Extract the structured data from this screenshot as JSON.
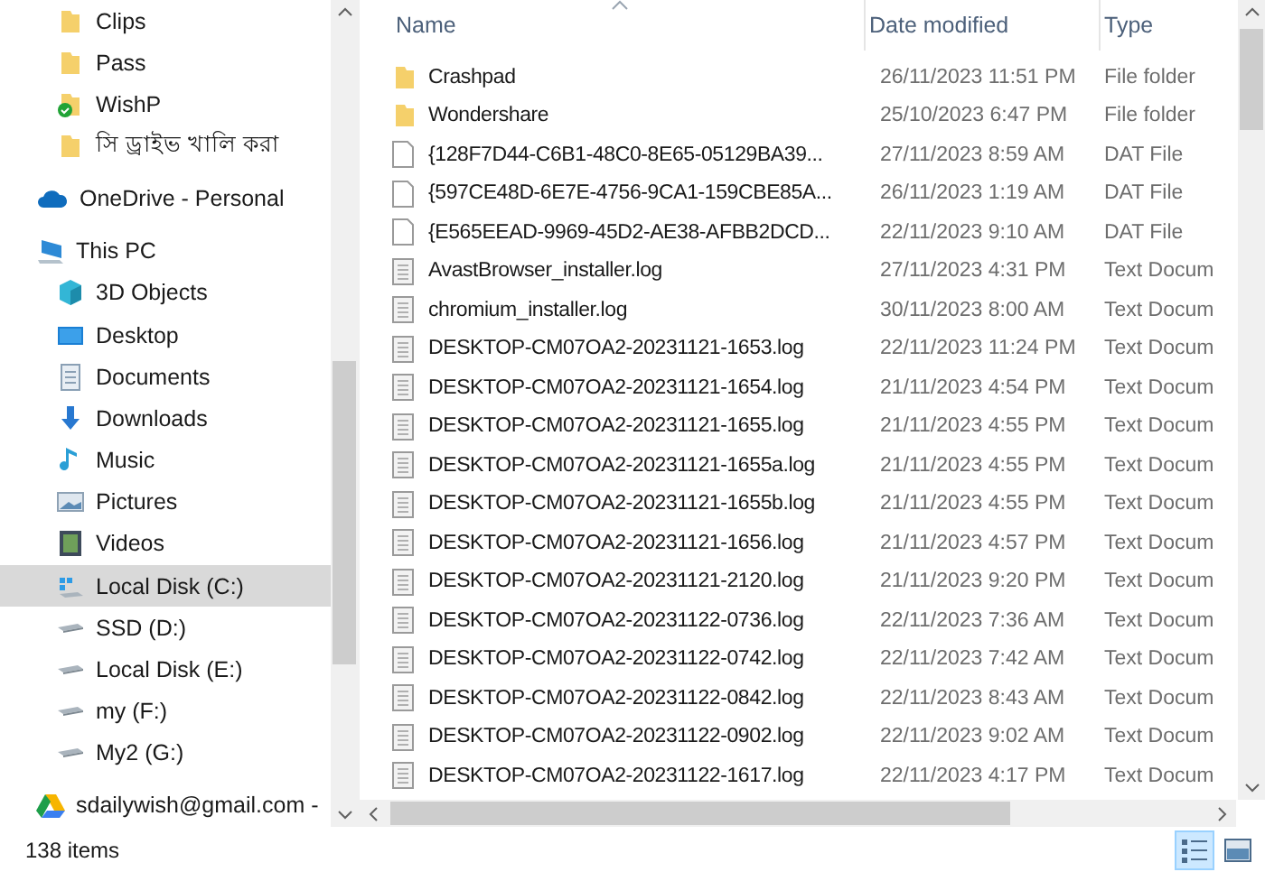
{
  "sidebar": {
    "quick_access_children": [
      {
        "label": "Clips",
        "kind": "folder",
        "selected": false
      },
      {
        "label": "Pass",
        "kind": "folder",
        "selected": false
      },
      {
        "label": "WishP",
        "kind": "synced-folder",
        "selected": false
      },
      {
        "label": "সি ড্রাইভ খালি করা",
        "kind": "folder",
        "selected": false
      }
    ],
    "items": [
      {
        "label": "OneDrive - Personal",
        "kind": "cloud",
        "selected": false
      },
      {
        "label": "This PC",
        "kind": "pc",
        "selected": false,
        "children": [
          {
            "label": "3D Objects",
            "kind": "cube",
            "selected": false
          },
          {
            "label": "Desktop",
            "kind": "desktop",
            "selected": false
          },
          {
            "label": "Documents",
            "kind": "documents",
            "selected": false
          },
          {
            "label": "Downloads",
            "kind": "downloads",
            "selected": false
          },
          {
            "label": "Music",
            "kind": "music",
            "selected": false
          },
          {
            "label": "Pictures",
            "kind": "pictures",
            "selected": false
          },
          {
            "label": "Videos",
            "kind": "videos",
            "selected": false
          },
          {
            "label": "Local Disk (C:)",
            "kind": "system-drive",
            "selected": true
          },
          {
            "label": "SSD (D:)",
            "kind": "drive",
            "selected": false
          },
          {
            "label": "Local Disk (E:)",
            "kind": "drive",
            "selected": false
          },
          {
            "label": "my (F:)",
            "kind": "drive",
            "selected": false
          },
          {
            "label": "My2 (G:)",
            "kind": "drive",
            "selected": false
          }
        ]
      },
      {
        "label": "sdailywish@gmail.com -",
        "kind": "gdrive",
        "selected": false
      }
    ]
  },
  "table": {
    "columns": [
      "Name",
      "Date modified",
      "Type"
    ],
    "rows": [
      {
        "name": "Crashpad",
        "date": "26/11/2023 11:51 PM",
        "type": "File folder",
        "kind": "folder"
      },
      {
        "name": "Wondershare",
        "date": "25/10/2023 6:47 PM",
        "type": "File folder",
        "kind": "folder"
      },
      {
        "name": "{128F7D44-C6B1-48C0-8E65-05129BA39...",
        "date": "27/11/2023 8:59 AM",
        "type": "DAT File",
        "kind": "blank"
      },
      {
        "name": "{597CE48D-6E7E-4756-9CA1-159CBE85A...",
        "date": "26/11/2023 1:19 AM",
        "type": "DAT File",
        "kind": "blank"
      },
      {
        "name": "{E565EEAD-9969-45D2-AE38-AFBB2DCD...",
        "date": "22/11/2023 9:10 AM",
        "type": "DAT File",
        "kind": "blank"
      },
      {
        "name": "AvastBrowser_installer.log",
        "date": "27/11/2023 4:31 PM",
        "type": "Text Docum",
        "kind": "text"
      },
      {
        "name": "chromium_installer.log",
        "date": "30/11/2023 8:00 AM",
        "type": "Text Docum",
        "kind": "text"
      },
      {
        "name": "DESKTOP-CM07OA2-20231121-1653.log",
        "date": "22/11/2023 11:24 PM",
        "type": "Text Docum",
        "kind": "text"
      },
      {
        "name": "DESKTOP-CM07OA2-20231121-1654.log",
        "date": "21/11/2023 4:54 PM",
        "type": "Text Docum",
        "kind": "text"
      },
      {
        "name": "DESKTOP-CM07OA2-20231121-1655.log",
        "date": "21/11/2023 4:55 PM",
        "type": "Text Docum",
        "kind": "text"
      },
      {
        "name": "DESKTOP-CM07OA2-20231121-1655a.log",
        "date": "21/11/2023 4:55 PM",
        "type": "Text Docum",
        "kind": "text"
      },
      {
        "name": "DESKTOP-CM07OA2-20231121-1655b.log",
        "date": "21/11/2023 4:55 PM",
        "type": "Text Docum",
        "kind": "text"
      },
      {
        "name": "DESKTOP-CM07OA2-20231121-1656.log",
        "date": "21/11/2023 4:57 PM",
        "type": "Text Docum",
        "kind": "text"
      },
      {
        "name": "DESKTOP-CM07OA2-20231121-2120.log",
        "date": "21/11/2023 9:20 PM",
        "type": "Text Docum",
        "kind": "text"
      },
      {
        "name": "DESKTOP-CM07OA2-20231122-0736.log",
        "date": "22/11/2023 7:36 AM",
        "type": "Text Docum",
        "kind": "text"
      },
      {
        "name": "DESKTOP-CM07OA2-20231122-0742.log",
        "date": "22/11/2023 7:42 AM",
        "type": "Text Docum",
        "kind": "text"
      },
      {
        "name": "DESKTOP-CM07OA2-20231122-0842.log",
        "date": "22/11/2023 8:43 AM",
        "type": "Text Docum",
        "kind": "text"
      },
      {
        "name": "DESKTOP-CM07OA2-20231122-0902.log",
        "date": "22/11/2023 9:02 AM",
        "type": "Text Docum",
        "kind": "text"
      },
      {
        "name": "DESKTOP-CM07OA2-20231122-1617.log",
        "date": "22/11/2023 4:17 PM",
        "type": "Text Docum",
        "kind": "text"
      }
    ]
  },
  "status_bar": {
    "item_count": "138 items",
    "view_buttons": [
      {
        "kind": "details",
        "selected": true
      },
      {
        "kind": "tiles",
        "selected": false
      }
    ]
  }
}
